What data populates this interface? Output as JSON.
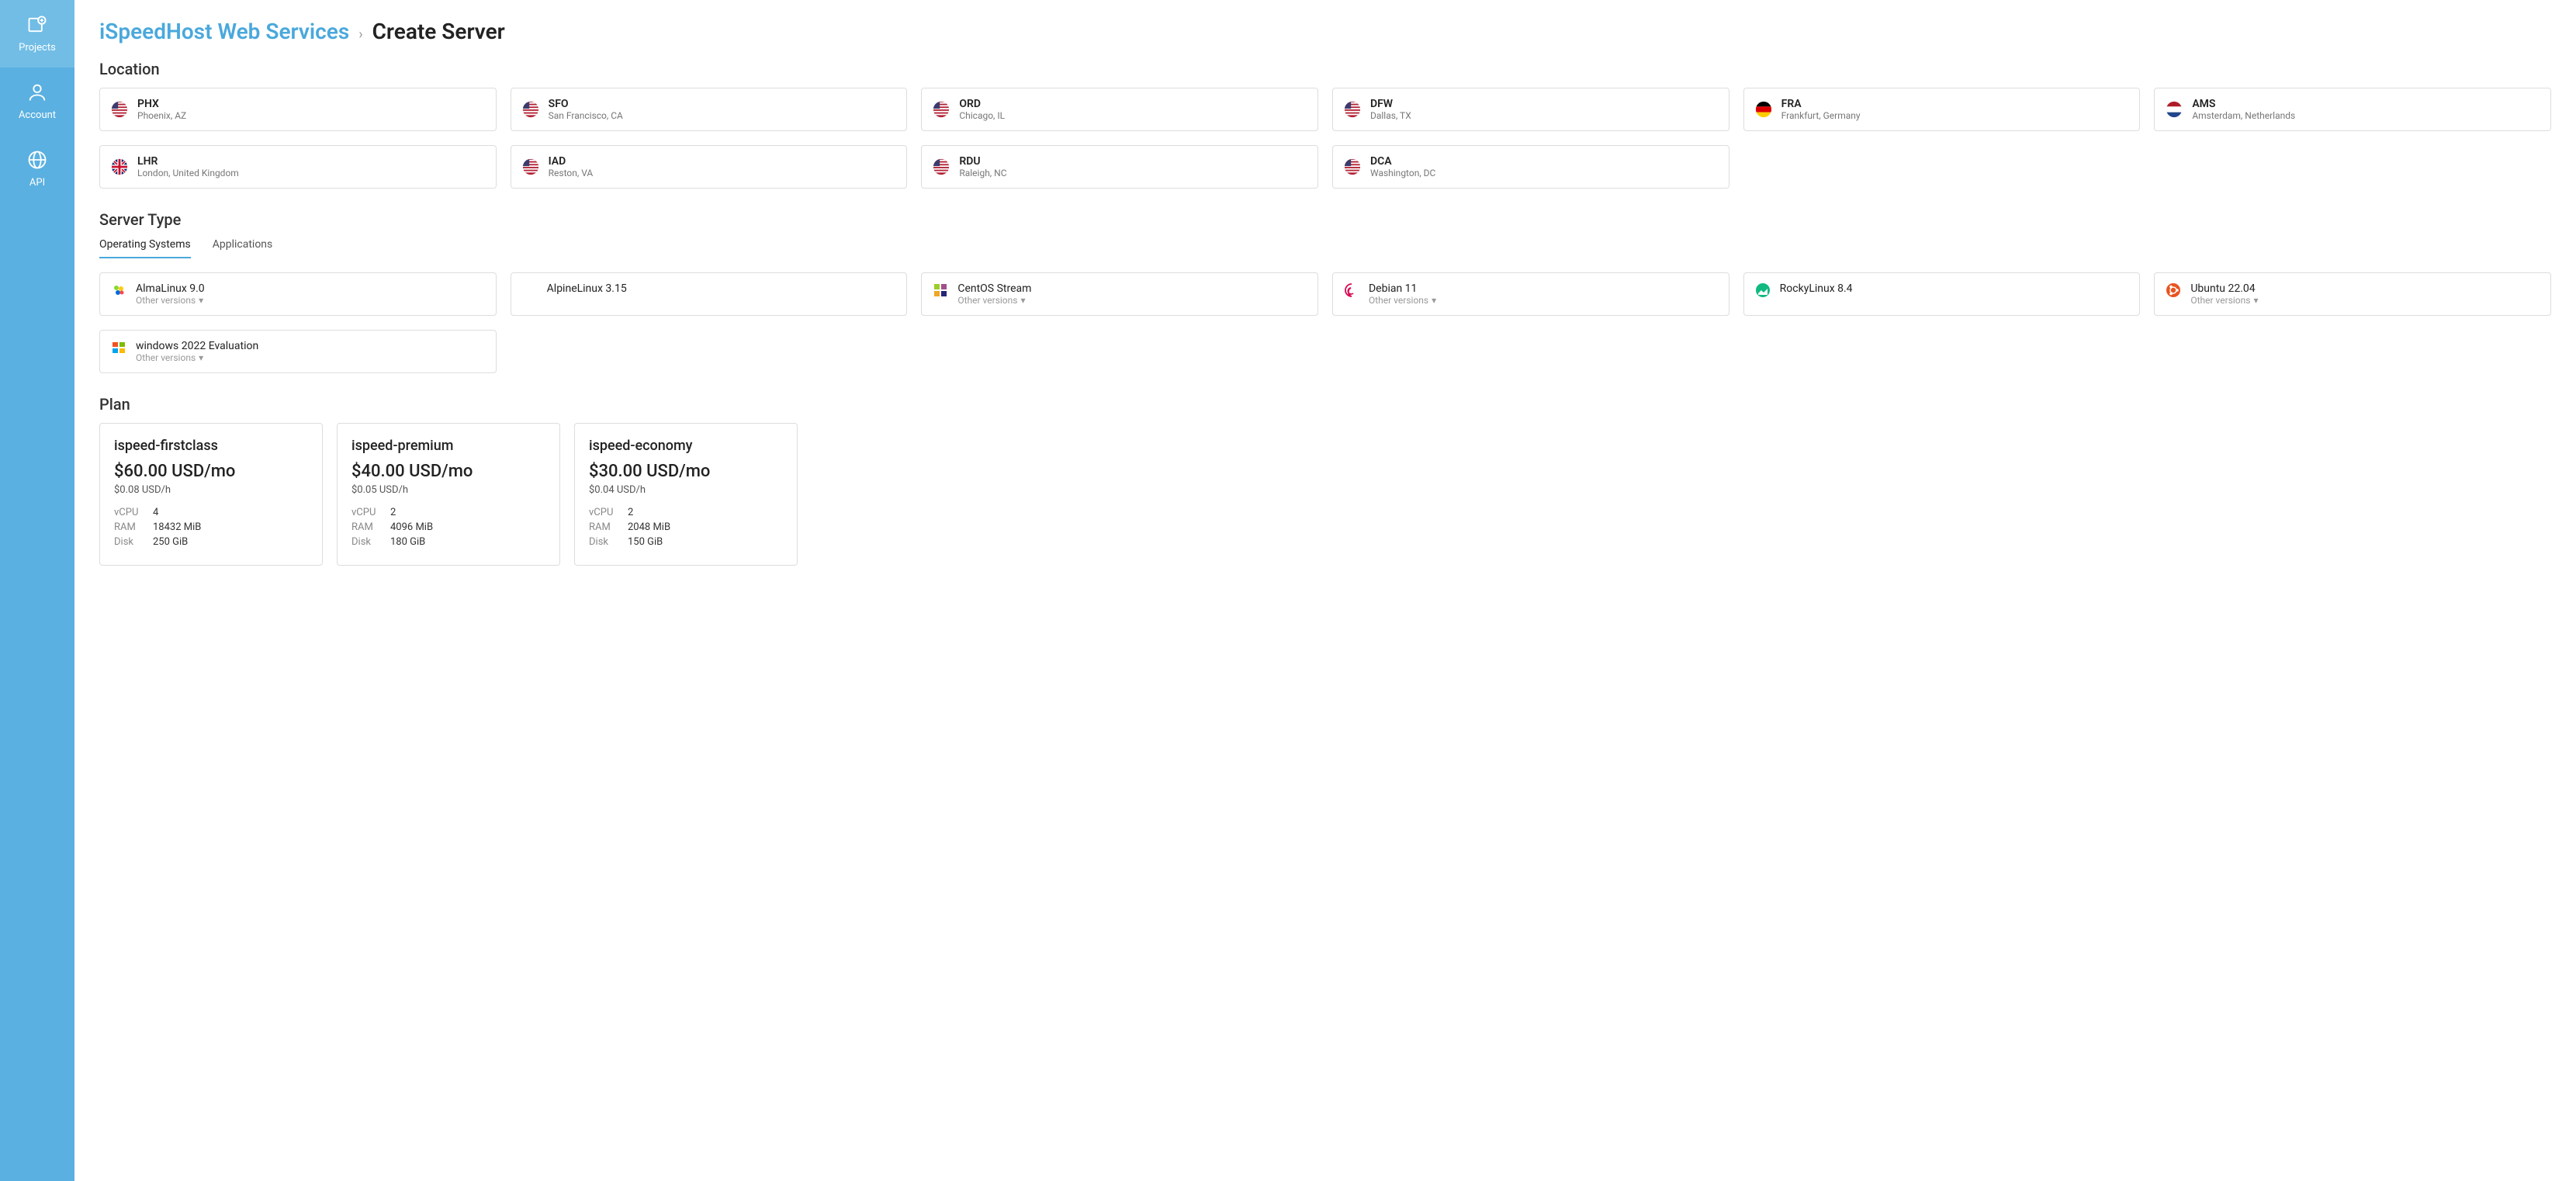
{
  "sidebar": {
    "items": [
      {
        "label": "Projects"
      },
      {
        "label": "Account"
      },
      {
        "label": "API"
      }
    ]
  },
  "breadcrumb": {
    "root": "iSpeedHost Web Services",
    "sep": "›",
    "current": "Create Server"
  },
  "sections": {
    "location": "Location",
    "server_type": "Server Type",
    "plan": "Plan"
  },
  "locations": [
    {
      "code": "PHX",
      "desc": "Phoenix, AZ",
      "flag": "us"
    },
    {
      "code": "SFO",
      "desc": "San Francisco, CA",
      "flag": "us"
    },
    {
      "code": "ORD",
      "desc": "Chicago, IL",
      "flag": "us"
    },
    {
      "code": "DFW",
      "desc": "Dallas, TX",
      "flag": "us"
    },
    {
      "code": "FRA",
      "desc": "Frankfurt, Germany",
      "flag": "de"
    },
    {
      "code": "AMS",
      "desc": "Amsterdam, Netherlands",
      "flag": "nl"
    },
    {
      "code": "LHR",
      "desc": "London, United Kingdom",
      "flag": "gb"
    },
    {
      "code": "IAD",
      "desc": "Reston, VA",
      "flag": "us"
    },
    {
      "code": "RDU",
      "desc": "Raleigh, NC",
      "flag": "us"
    },
    {
      "code": "DCA",
      "desc": "Washington, DC",
      "flag": "us"
    }
  ],
  "tabs": {
    "os": "Operating Systems",
    "apps": "Applications"
  },
  "os_other": "Other versions",
  "os_list": [
    {
      "name": "AlmaLinux 9.0",
      "other": true,
      "icon": "alma"
    },
    {
      "name": "AlpineLinux 3.15",
      "other": false,
      "icon": "alpine"
    },
    {
      "name": "CentOS Stream",
      "other": true,
      "icon": "centos"
    },
    {
      "name": "Debian 11",
      "other": true,
      "icon": "debian"
    },
    {
      "name": "RockyLinux 8.4",
      "other": false,
      "icon": "rocky"
    },
    {
      "name": "Ubuntu 22.04",
      "other": true,
      "icon": "ubuntu"
    },
    {
      "name": "windows 2022 Evaluation",
      "other": true,
      "icon": "windows"
    }
  ],
  "plans": [
    {
      "name": "ispeed-firstclass",
      "price": "$60.00 USD/mo",
      "hourly": "$0.08 USD/h",
      "vcpu": "4",
      "ram": "18432 MiB",
      "disk": "250 GiB"
    },
    {
      "name": "ispeed-premium",
      "price": "$40.00 USD/mo",
      "hourly": "$0.05 USD/h",
      "vcpu": "2",
      "ram": "4096 MiB",
      "disk": "180 GiB"
    },
    {
      "name": "ispeed-economy",
      "price": "$30.00 USD/mo",
      "hourly": "$0.04 USD/h",
      "vcpu": "2",
      "ram": "2048 MiB",
      "disk": "150 GiB"
    }
  ],
  "spec_labels": {
    "vcpu": "vCPU",
    "ram": "RAM",
    "disk": "Disk"
  }
}
